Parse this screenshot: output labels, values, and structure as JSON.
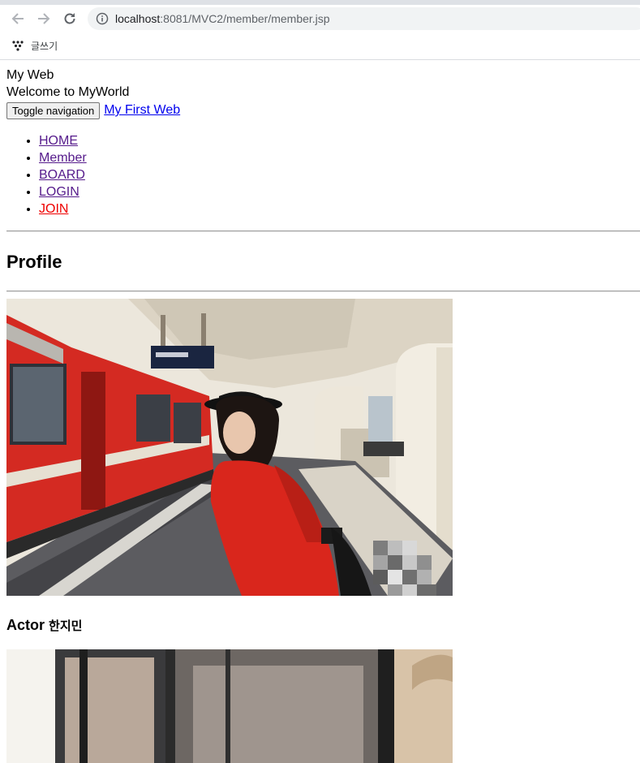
{
  "browser": {
    "url_host": "localhost",
    "url_rest": ":8081/MVC2/member/member.jsp",
    "bookmark_label": "글쓰기",
    "icons": [
      "back-arrow-icon",
      "forward-arrow-icon",
      "reload-icon",
      "info-icon",
      "bookmark-app-icon"
    ]
  },
  "page": {
    "brand_title": "My Web",
    "brand_subtitle": "Welcome to MyWorld",
    "toggle_label": "Toggle navigation",
    "brand_link": "My First Web",
    "menu": [
      {
        "label": "HOME",
        "active": false
      },
      {
        "label": "Member",
        "active": false
      },
      {
        "label": "BOARD",
        "active": false
      },
      {
        "label": "LOGIN",
        "active": false
      },
      {
        "label": "JOIN",
        "active": true
      }
    ],
    "heading": "Profile",
    "caption_role": "Actor",
    "caption_name": "한지민"
  },
  "colors": {
    "link_visited": "#551a8b",
    "link_active": "#ee0000",
    "link": "#0000ee",
    "train_red": "#d42a22"
  }
}
